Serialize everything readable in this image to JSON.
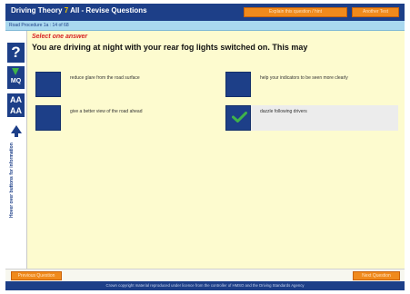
{
  "header": {
    "title_prefix": "Driving Theory",
    "title_glyph": "7",
    "title_suffix": "All - Revise Questions",
    "explain_button": "Explain this question / hint",
    "another_button": "Another Test"
  },
  "subheader": {
    "progress": "Road Procedure 1a : 14 of 68"
  },
  "sidebar": {
    "help_label": "?",
    "mq_label": "MQ",
    "font_label_1": "AA",
    "font_label_2": "AA",
    "vertical_text": "Hover over buttons for information"
  },
  "question": {
    "instruction": "Select one answer",
    "text": "You are driving at night with your rear fog lights switched on. This may"
  },
  "answers": [
    {
      "text": "reduce glare from the road surface",
      "selected": false
    },
    {
      "text": "help your indicators to be seen more clearly",
      "selected": false
    },
    {
      "text": "give a better view of the road ahead",
      "selected": false
    },
    {
      "text": "dazzle following drivers",
      "selected": true
    }
  ],
  "navigation": {
    "previous_label": "Previous Question",
    "next_label": "Next Question"
  },
  "footer": {
    "text": "Crown copyright material reproduced under licence from the controller of HMSO and the Driving Standards Agency"
  },
  "colors": {
    "brand_blue": "#1d3f88",
    "accent_orange": "#f08a1c",
    "answer_area": "#fdfbcf",
    "instruction_red": "#d72222",
    "check_green": "#3fb34a"
  }
}
